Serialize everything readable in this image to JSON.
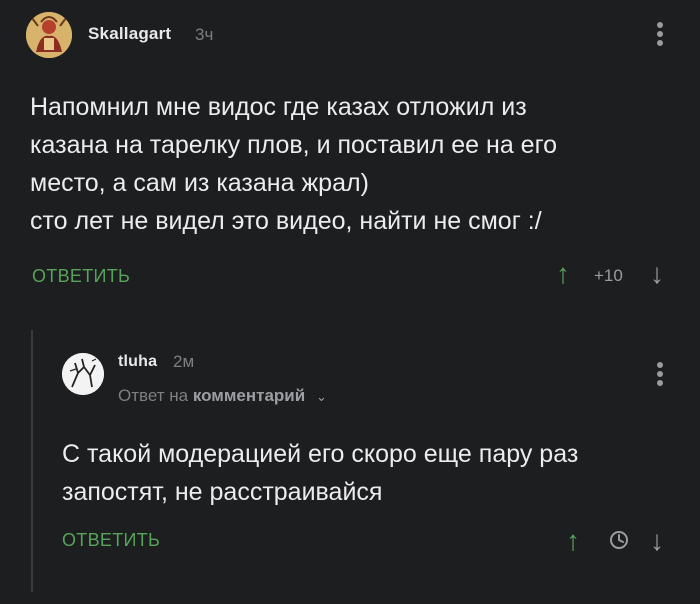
{
  "comments": [
    {
      "username": "Skallagart",
      "time": "3ч",
      "text_lines": [
        "Напомнил мне видос где казах отложил из",
        "казана на тарелку плов, и поставил ее на его",
        "место, а сам из казана жрал)",
        "сто лет не видел это видео, найти не смог :/"
      ],
      "reply_label": "ОТВЕТИТЬ",
      "score": "+10"
    },
    {
      "username": "tluha",
      "time": "2м",
      "reply_to_prefix": "Ответ на",
      "reply_to_target": "комментарий",
      "text_lines": [
        "С такой модерацией его скоро еще пару раз",
        "запостят, не расстраивайся"
      ],
      "reply_label": "ОТВЕТИТЬ"
    }
  ],
  "icons": {
    "vote_up": "↑",
    "vote_down": "↓",
    "clock": "clock-icon",
    "menu": "more-vertical-icon",
    "chevron": "⌄"
  },
  "colors": {
    "background": "#1d1e20",
    "accent_green": "#57a35a",
    "muted": "#7d7f82",
    "text": "#ececec"
  }
}
